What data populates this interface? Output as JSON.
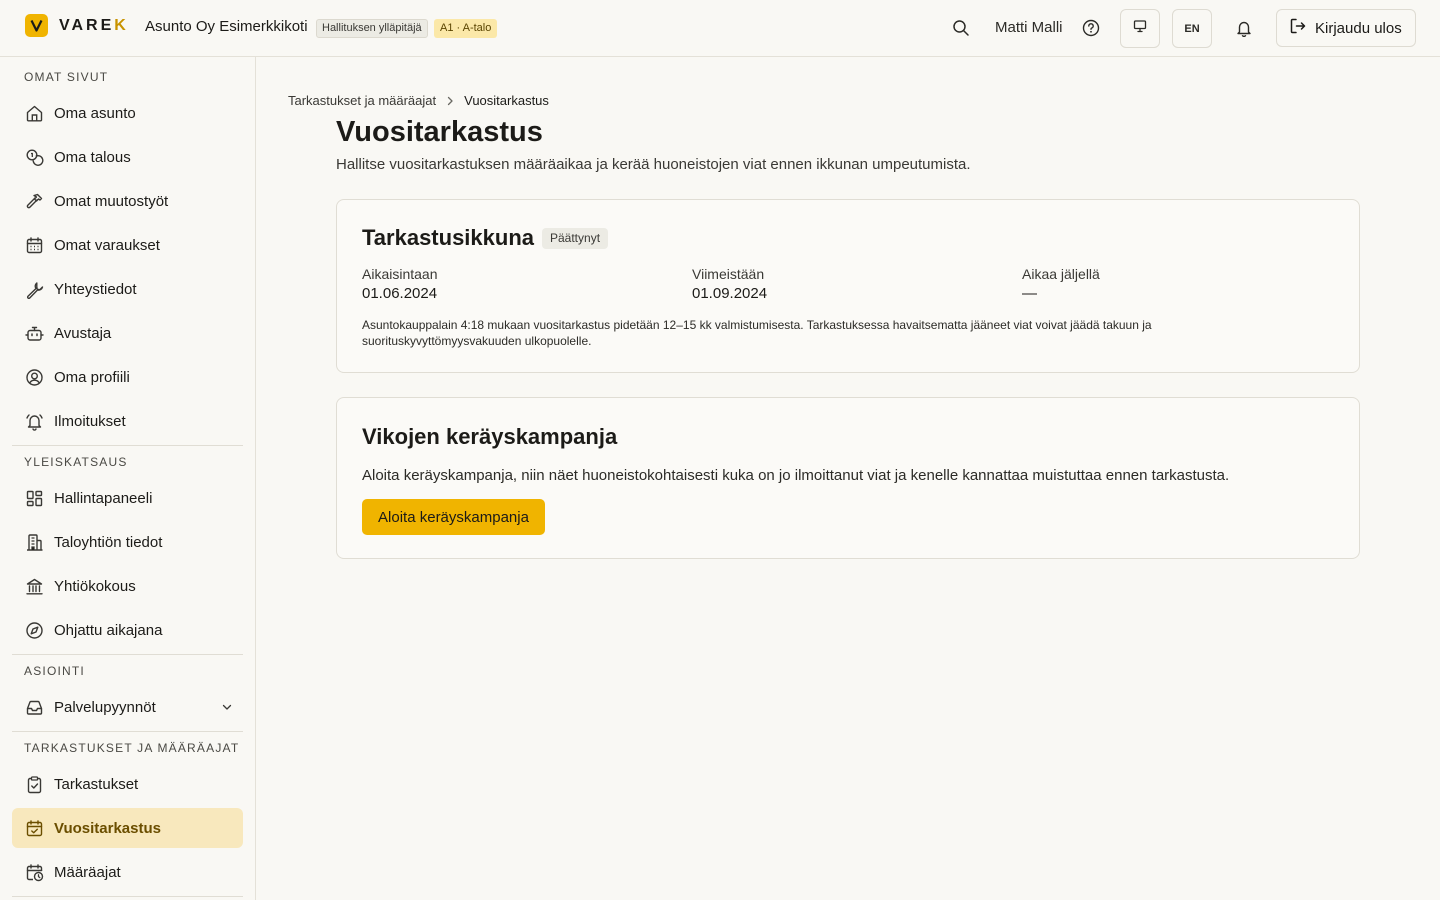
{
  "header": {
    "brand": "VARE",
    "brand_suffix": "K",
    "org_name": "Asunto Oy Esimerkkikoti",
    "role_badge": "Hallituksen ylläpitäjä",
    "apartment_badge": "A1 · A-talo",
    "user_name": "Matti Malli",
    "language": "EN",
    "logout_label": "Kirjaudu ulos",
    "accent_color": "#f0b400"
  },
  "sidebar": {
    "sections": [
      {
        "title": "OMAT SIVUT",
        "items": [
          {
            "label": "Oma asunto",
            "icon": "home-icon"
          },
          {
            "label": "Oma talous",
            "icon": "coins-icon"
          },
          {
            "label": "Omat muutostyöt",
            "icon": "hammer-icon"
          },
          {
            "label": "Omat varaukset",
            "icon": "calendar-icon"
          },
          {
            "label": "Yhteystiedot",
            "icon": "wrench-icon"
          },
          {
            "label": "Avustaja",
            "icon": "bot-icon"
          },
          {
            "label": "Oma profiili",
            "icon": "user-circle-icon"
          },
          {
            "label": "Ilmoitukset",
            "icon": "bell-ring-icon"
          }
        ]
      },
      {
        "title": "YLEISKATSAUS",
        "items": [
          {
            "label": "Hallintapaneeli",
            "icon": "dashboard-icon"
          },
          {
            "label": "Taloyhtiön tiedot",
            "icon": "building-icon"
          },
          {
            "label": "Yhtiökokous",
            "icon": "landmark-icon"
          },
          {
            "label": "Ohjattu aikajana",
            "icon": "compass-icon"
          }
        ]
      },
      {
        "title": "ASIOINTI",
        "items": [
          {
            "label": "Palvelupyynnöt",
            "icon": "inbox-icon"
          }
        ]
      },
      {
        "title": "TARKASTUKSET JA MÄÄRÄAJAT",
        "items": [
          {
            "label": "Tarkastukset",
            "icon": "clipboard-check-icon"
          },
          {
            "label": "Vuositarkastus",
            "icon": "calendar-check-icon",
            "active": true
          },
          {
            "label": "Määräajat",
            "icon": "calendar-clock-icon"
          }
        ]
      }
    ]
  },
  "breadcrumb": {
    "parent": "Tarkastukset ja määräajat",
    "current": "Vuositarkastus"
  },
  "page": {
    "title": "Vuositarkastus",
    "subtitle": "Hallitse vuositarkastuksen määräaikaa ja kerää huoneistojen viat ennen ikkunan umpeutumista."
  },
  "window_card": {
    "title": "Tarkastusikkuna",
    "status": "Päättynyt",
    "fields": [
      {
        "label": "Aikaisintaan",
        "value": "01.06.2024"
      },
      {
        "label": "Viimeistään",
        "value": "01.09.2024"
      },
      {
        "label": "Aikaa jäljellä",
        "value": "—"
      }
    ],
    "note": "Asuntokauppalain 4:18 mukaan vuositarkastus pidetään 12–15 kk valmistumisesta. Tarkastuksessa havaitsematta jääneet viat voivat jäädä takuun ja suorituskyvyttömyysvakuuden ulkopuolelle."
  },
  "campaign_card": {
    "title": "Vikojen keräyskampanja",
    "text": "Aloita keräyskampanja, niin näet huoneistokohtaisesti kuka on jo ilmoittanut viat ja kenelle kannattaa muistuttaa ennen tarkastusta.",
    "button_label": "Aloita keräyskampanja"
  }
}
